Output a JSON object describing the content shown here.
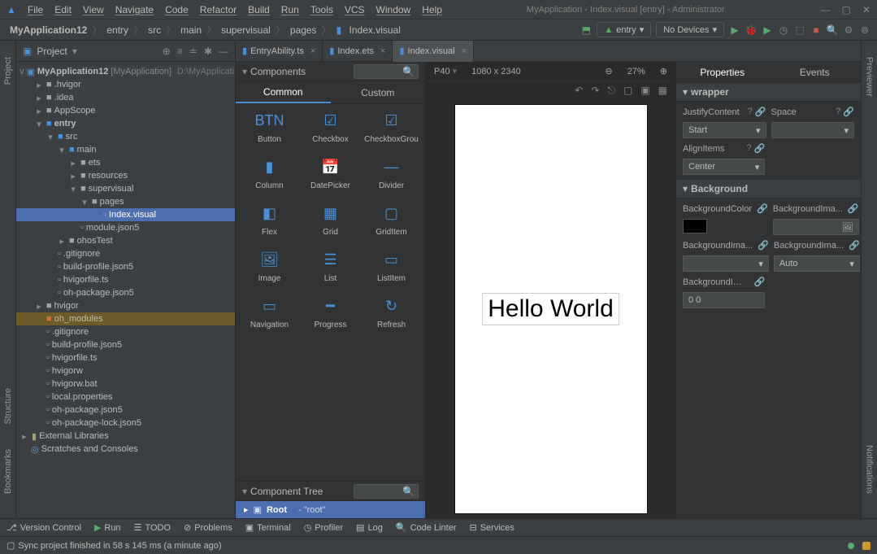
{
  "menubar": {
    "items": [
      "File",
      "Edit",
      "View",
      "Navigate",
      "Code",
      "Refactor",
      "Build",
      "Run",
      "Tools",
      "VCS",
      "Window",
      "Help"
    ],
    "title": "MyApplication - Index.visual [entry] - Administrator"
  },
  "breadcrumb": {
    "root": "MyApplication12",
    "items": [
      "entry",
      "src",
      "main",
      "supervisual",
      "pages"
    ],
    "file": "Index.visual"
  },
  "toolbar": {
    "entry_label": "entry",
    "devices_label": "No Devices"
  },
  "project_panel": {
    "title": "Project"
  },
  "tree": {
    "root": "MyApplication12",
    "root_meta": "[MyApplication]",
    "root_path": "D:\\MyApplicatio",
    "items": [
      {
        "depth": 1,
        "name": ".hvigor",
        "icon": "folder",
        "exp": ">"
      },
      {
        "depth": 1,
        "name": ".idea",
        "icon": "folder",
        "exp": ">"
      },
      {
        "depth": 1,
        "name": "AppScope",
        "icon": "folder",
        "exp": ">"
      },
      {
        "depth": 1,
        "name": "entry",
        "icon": "folder-src",
        "exp": "v",
        "bold": true
      },
      {
        "depth": 2,
        "name": "src",
        "icon": "folder-src",
        "exp": "v"
      },
      {
        "depth": 3,
        "name": "main",
        "icon": "folder-src",
        "exp": "v"
      },
      {
        "depth": 4,
        "name": "ets",
        "icon": "folder",
        "exp": ">"
      },
      {
        "depth": 4,
        "name": "resources",
        "icon": "folder",
        "exp": ">"
      },
      {
        "depth": 4,
        "name": "supervisual",
        "icon": "folder",
        "exp": "v"
      },
      {
        "depth": 5,
        "name": "pages",
        "icon": "folder",
        "exp": "v"
      },
      {
        "depth": 6,
        "name": "Index.visual",
        "icon": "file",
        "selected": true
      },
      {
        "depth": 4,
        "name": "module.json5",
        "icon": "file"
      },
      {
        "depth": 3,
        "name": "ohosTest",
        "icon": "folder",
        "exp": ">"
      },
      {
        "depth": 2,
        "name": ".gitignore",
        "icon": "file"
      },
      {
        "depth": 2,
        "name": "build-profile.json5",
        "icon": "file"
      },
      {
        "depth": 2,
        "name": "hvigorfile.ts",
        "icon": "file"
      },
      {
        "depth": 2,
        "name": "oh-package.json5",
        "icon": "file"
      },
      {
        "depth": 1,
        "name": "hvigor",
        "icon": "folder",
        "exp": ">"
      },
      {
        "depth": 1,
        "name": "oh_modules",
        "icon": "folder-orange",
        "orange": true
      },
      {
        "depth": 1,
        "name": ".gitignore",
        "icon": "file"
      },
      {
        "depth": 1,
        "name": "build-profile.json5",
        "icon": "file"
      },
      {
        "depth": 1,
        "name": "hvigorfile.ts",
        "icon": "file"
      },
      {
        "depth": 1,
        "name": "hvigorw",
        "icon": "file"
      },
      {
        "depth": 1,
        "name": "hvigorw.bat",
        "icon": "file"
      },
      {
        "depth": 1,
        "name": "local.properties",
        "icon": "file"
      },
      {
        "depth": 1,
        "name": "oh-package.json5",
        "icon": "file"
      },
      {
        "depth": 1,
        "name": "oh-package-lock.json5",
        "icon": "file"
      }
    ],
    "external": "External Libraries",
    "scratches": "Scratches and Consoles"
  },
  "left_rail": {
    "project": "Project",
    "structure": "Structure",
    "bookmarks": "Bookmarks"
  },
  "right_rail": {
    "previewer": "Previewer",
    "notifications": "Notifications"
  },
  "tabs": [
    {
      "label": "EntryAbility.ts",
      "active": false
    },
    {
      "label": "Index.ets",
      "active": false
    },
    {
      "label": "Index.visual",
      "active": true
    }
  ],
  "components": {
    "title": "Components",
    "tab_common": "Common",
    "tab_custom": "Custom",
    "items": [
      {
        "label": "Button",
        "glyph": "BTN"
      },
      {
        "label": "Checkbox",
        "glyph": "☑"
      },
      {
        "label": "CheckboxGrou",
        "glyph": "☑"
      },
      {
        "label": "Column",
        "glyph": "▮"
      },
      {
        "label": "DatePicker",
        "glyph": "📅"
      },
      {
        "label": "Divider",
        "glyph": "—"
      },
      {
        "label": "Flex",
        "glyph": "◧"
      },
      {
        "label": "Grid",
        "glyph": "▦"
      },
      {
        "label": "GridItem",
        "glyph": "▢"
      },
      {
        "label": "Image",
        "glyph": "🖼"
      },
      {
        "label": "List",
        "glyph": "☰"
      },
      {
        "label": "ListItem",
        "glyph": "▭"
      },
      {
        "label": "Navigation",
        "glyph": "▭"
      },
      {
        "label": "Progress",
        "glyph": "━"
      },
      {
        "label": "Refresh",
        "glyph": "↻"
      }
    ]
  },
  "comp_tree": {
    "title": "Component Tree",
    "root": "Root",
    "root_meta": "- \"root\""
  },
  "preview": {
    "device": "P40",
    "resolution": "1080 x 2340",
    "zoom": "27%",
    "text": "Hello World"
  },
  "properties": {
    "tab_props": "Properties",
    "tab_events": "Events",
    "section_wrapper": "wrapper",
    "justify_label": "JustifyContent",
    "justify_value": "Start",
    "space_label": "Space",
    "align_label": "AlignItems",
    "align_value": "Center",
    "section_bg": "Background",
    "bgcolor_label": "BackgroundColor",
    "bgimage_label": "BackgroundIma...",
    "bgimage2_label": "BackgroundIma...",
    "bgimage3_label": "BackgroundIma...",
    "auto_value": "Auto",
    "bgimage4_label": "BackgroundIma...",
    "zero_value": "0 0"
  },
  "status_tools": {
    "vcs": "Version Control",
    "run": "Run",
    "todo": "TODO",
    "problems": "Problems",
    "terminal": "Terminal",
    "profiler": "Profiler",
    "log": "Log",
    "linter": "Code Linter",
    "services": "Services"
  },
  "statusbar": {
    "msg": "Sync project finished in 58 s 145 ms (a minute ago)"
  }
}
